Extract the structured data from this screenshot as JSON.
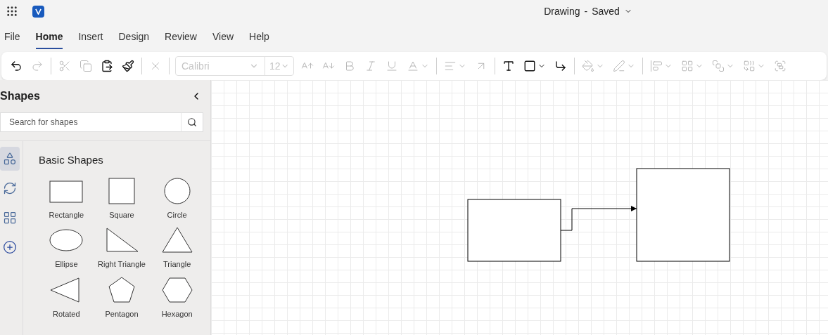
{
  "title_bar": {
    "document": "Drawing",
    "separator": "-",
    "status": "Saved"
  },
  "menu_tabs": [
    {
      "label": "File",
      "selected": false
    },
    {
      "label": "Home",
      "selected": true
    },
    {
      "label": "Insert",
      "selected": false
    },
    {
      "label": "Design",
      "selected": false
    },
    {
      "label": "Review",
      "selected": false
    },
    {
      "label": "View",
      "selected": false
    },
    {
      "label": "Help",
      "selected": false
    }
  ],
  "toolbar": [
    {
      "kind": "undo",
      "disabled": false
    },
    {
      "kind": "redo",
      "disabled": true
    },
    {
      "kind": "divider"
    },
    {
      "kind": "cut",
      "disabled": true
    },
    {
      "kind": "copy",
      "disabled": true
    },
    {
      "kind": "paste",
      "disabled": false
    },
    {
      "kind": "painter",
      "disabled": false
    },
    {
      "kind": "divider"
    },
    {
      "kind": "delete",
      "disabled": true
    },
    {
      "kind": "divider"
    },
    {
      "kind": "font",
      "value": "Calibri",
      "size": "12",
      "disabled": true
    },
    {
      "kind": "grow",
      "disabled": true
    },
    {
      "kind": "shrink",
      "disabled": true
    },
    {
      "kind": "bold",
      "disabled": true
    },
    {
      "kind": "italic",
      "disabled": true
    },
    {
      "kind": "underline",
      "disabled": true
    },
    {
      "kind": "fontcolor",
      "disabled": true
    },
    {
      "kind": "divider"
    },
    {
      "kind": "align",
      "disabled": true
    },
    {
      "kind": "direction",
      "disabled": true
    },
    {
      "kind": "divider"
    },
    {
      "kind": "textbox",
      "disabled": false
    },
    {
      "kind": "shape",
      "disabled": false
    },
    {
      "kind": "connector",
      "disabled": false
    },
    {
      "kind": "divider"
    },
    {
      "kind": "fill",
      "disabled": true
    },
    {
      "kind": "line",
      "disabled": true
    },
    {
      "kind": "divider"
    },
    {
      "kind": "position",
      "disabled": true
    },
    {
      "kind": "distribute",
      "disabled": true
    },
    {
      "kind": "forward",
      "disabled": true
    },
    {
      "kind": "arrange",
      "disabled": true
    },
    {
      "kind": "group",
      "disabled": true
    }
  ],
  "shapes_panel": {
    "title": "Shapes",
    "search": {
      "placeholder": "Search for shapes"
    },
    "categories": [
      {
        "kind": "basic",
        "selected": true
      },
      {
        "kind": "cycle",
        "selected": false
      },
      {
        "kind": "diagram",
        "selected": false
      },
      {
        "kind": "add",
        "selected": false
      }
    ],
    "section": "Basic Shapes",
    "shapes": [
      {
        "kind": "rectangle",
        "label": "Rectangle"
      },
      {
        "kind": "square",
        "label": "Square"
      },
      {
        "kind": "circle",
        "label": "Circle"
      },
      {
        "kind": "ellipse",
        "label": "Ellipse"
      },
      {
        "kind": "right-triangle",
        "label": "Right Triangle"
      },
      {
        "kind": "triangle",
        "label": "Triangle"
      },
      {
        "kind": "rotated-triangle",
        "label": "Rotated"
      },
      {
        "kind": "pentagon",
        "label": "Pentagon"
      },
      {
        "kind": "hexagon",
        "label": "Hexagon"
      }
    ]
  },
  "canvas": {
    "shapes": [
      {
        "kind": "rectangle"
      },
      {
        "kind": "square"
      }
    ],
    "connector": {
      "arrow": true
    }
  }
}
